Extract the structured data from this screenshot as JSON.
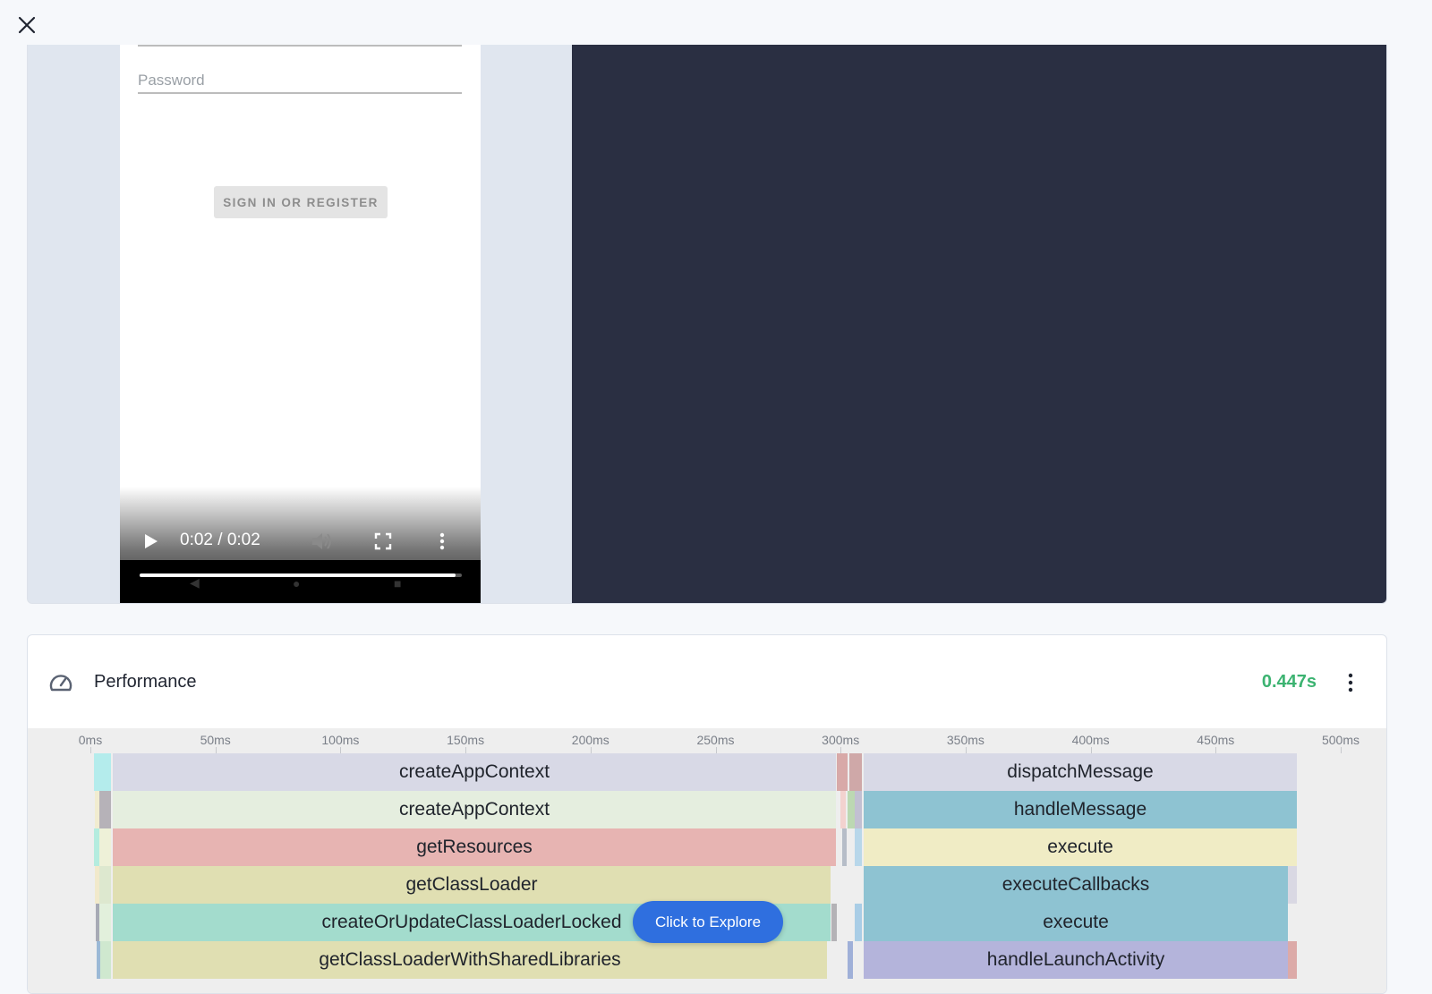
{
  "window": {
    "close_icon": "close-icon"
  },
  "media": {
    "password_placeholder": "Password",
    "signin_button": "SIGN IN OR REGISTER",
    "video": {
      "time": "0:02 / 0:02",
      "progress_fraction": 0.98,
      "icons": [
        "play-icon",
        "volume-icon",
        "fullscreen-icon",
        "more-vertical-icon"
      ]
    }
  },
  "performance": {
    "title": "Performance",
    "icon": "speedometer-icon",
    "total_time": "0.447s",
    "total_color": "#3cb371",
    "explore_button": "Click to Explore",
    "axis_ticks": [
      "0ms",
      "50ms",
      "100ms",
      "150ms",
      "200ms",
      "250ms",
      "300ms",
      "350ms",
      "400ms",
      "450ms",
      "500ms"
    ],
    "rows": [
      {
        "left": "createAppContext",
        "right": "dispatchMessage"
      },
      {
        "left": "createAppContext",
        "right": "handleMessage"
      },
      {
        "left": "getResources",
        "right": "execute"
      },
      {
        "left": "getClassLoader",
        "right": "executeCallbacks"
      },
      {
        "left": "createOrUpdateClassLoaderLocked",
        "right": "execute"
      },
      {
        "left": "getClassLoaderWithSharedLibraries",
        "right": "handleLaunchActivity"
      }
    ]
  }
}
